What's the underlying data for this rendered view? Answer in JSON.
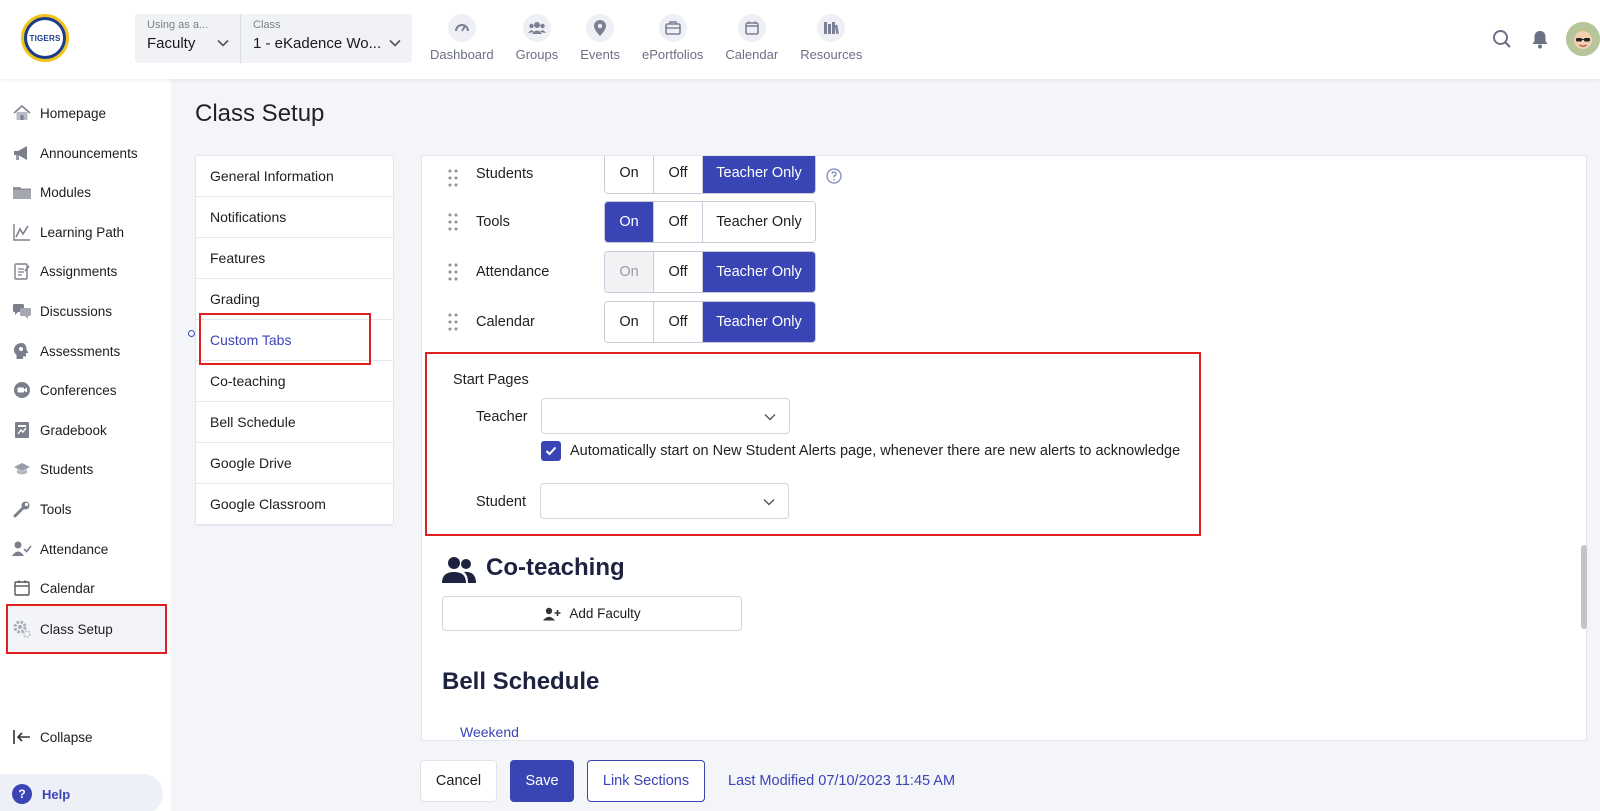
{
  "logo_text": "TIGERS",
  "header": {
    "using_as": {
      "caption": "Using as a...",
      "value": "Faculty"
    },
    "class": {
      "caption": "Class",
      "value": "1 - eKadence Wo..."
    },
    "nav": [
      {
        "label": "Dashboard",
        "icon": "dashboard-gauge-icon"
      },
      {
        "label": "Groups",
        "icon": "groups-icon"
      },
      {
        "label": "Events",
        "icon": "location-pin-icon"
      },
      {
        "label": "ePortfolios",
        "icon": "briefcase-icon"
      },
      {
        "label": "Calendar",
        "icon": "calendar-icon"
      },
      {
        "label": "Resources",
        "icon": "books-icon"
      }
    ]
  },
  "sidebar": {
    "items": [
      {
        "label": "Homepage",
        "icon": "home-icon"
      },
      {
        "label": "Announcements",
        "icon": "megaphone-icon"
      },
      {
        "label": "Modules",
        "icon": "folder-icon"
      },
      {
        "label": "Learning Path",
        "icon": "path-chart-icon"
      },
      {
        "label": "Assignments",
        "icon": "clipboard-icon"
      },
      {
        "label": "Discussions",
        "icon": "chat-bubbles-icon"
      },
      {
        "label": "Assessments",
        "icon": "brain-head-icon"
      },
      {
        "label": "Conferences",
        "icon": "video-chat-icon"
      },
      {
        "label": "Gradebook",
        "icon": "gradebook-icon"
      },
      {
        "label": "Students",
        "icon": "graduation-cap-icon"
      },
      {
        "label": "Tools",
        "icon": "wrench-icon"
      },
      {
        "label": "Attendance",
        "icon": "user-check-icon"
      },
      {
        "label": "Calendar",
        "icon": "calendar-icon"
      },
      {
        "label": "Class Setup",
        "icon": "gears-icon"
      }
    ],
    "collapse": "Collapse",
    "help": "Help"
  },
  "page_title": "Class Setup",
  "setup_menu": [
    "General Information",
    "Notifications",
    "Features",
    "Grading",
    "Custom Tabs",
    "Co-teaching",
    "Bell Schedule",
    "Google Drive",
    "Google Classroom"
  ],
  "tabs": [
    {
      "name": "Students",
      "selected": "Teacher Only",
      "disabled": ""
    },
    {
      "name": "Tools",
      "selected": "On",
      "disabled": ""
    },
    {
      "name": "Attendance",
      "selected": "Teacher Only",
      "disabled": "On"
    },
    {
      "name": "Calendar",
      "selected": "Teacher Only",
      "disabled": ""
    }
  ],
  "toggle_options": [
    "On",
    "Off",
    "Teacher Only"
  ],
  "start_pages": {
    "title": "Start Pages",
    "teacher_label": "Teacher",
    "teacher_value": "",
    "checkbox_checked": true,
    "checkbox_label": "Automatically start on New Student Alerts page, whenever there are new alerts to acknowledge",
    "student_label": "Student",
    "student_value": ""
  },
  "coteaching": {
    "heading": "Co-teaching",
    "add_button": "Add Faculty"
  },
  "bell_schedule": {
    "heading": "Bell Schedule",
    "first_item": "Weekend"
  },
  "footer": {
    "cancel": "Cancel",
    "save": "Save",
    "link_sections": "Link Sections",
    "last_modified": "Last Modified 07/10/2023 11:45 AM"
  },
  "colors": {
    "accent": "#3944b5",
    "highlight_red": "#e02020",
    "logo_blue": "#1e3c8c",
    "logo_gold": "#f0c419"
  }
}
